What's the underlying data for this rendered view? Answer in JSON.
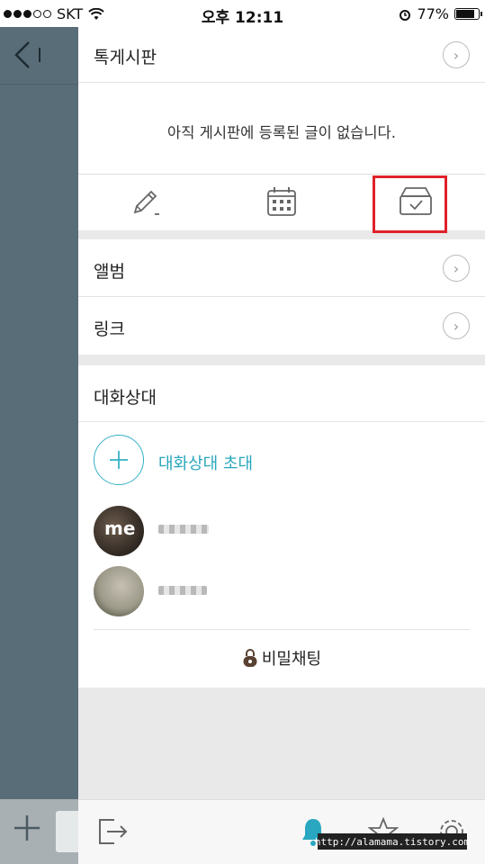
{
  "status": {
    "carrier": "SKT",
    "time": "오후 12:11",
    "battery": "77%",
    "battery_level": 0.77
  },
  "sidebar": {
    "back_label": "<I"
  },
  "panel": {
    "board": {
      "title": "톡게시판",
      "empty_message": "아직 게시판에 등록된 글이 없습니다.",
      "tools": [
        "pencil-icon",
        "calendar-icon",
        "archive-box-icon"
      ]
    },
    "album_label": "앨범",
    "link_label": "링크",
    "chat_partners_title": "대화상대",
    "invite_label": "대화상대 초대",
    "me_badge": "me",
    "secret_chat_label": "비밀채팅"
  },
  "bottom_icons": [
    "exit-icon",
    "bell-icon",
    "star-icon",
    "gear-icon"
  ],
  "watermark": "http://alamama.tistory.com",
  "colors": {
    "accent": "#35b1c6",
    "highlight": "#e0222a",
    "sidebar_bg": "#596d78"
  }
}
